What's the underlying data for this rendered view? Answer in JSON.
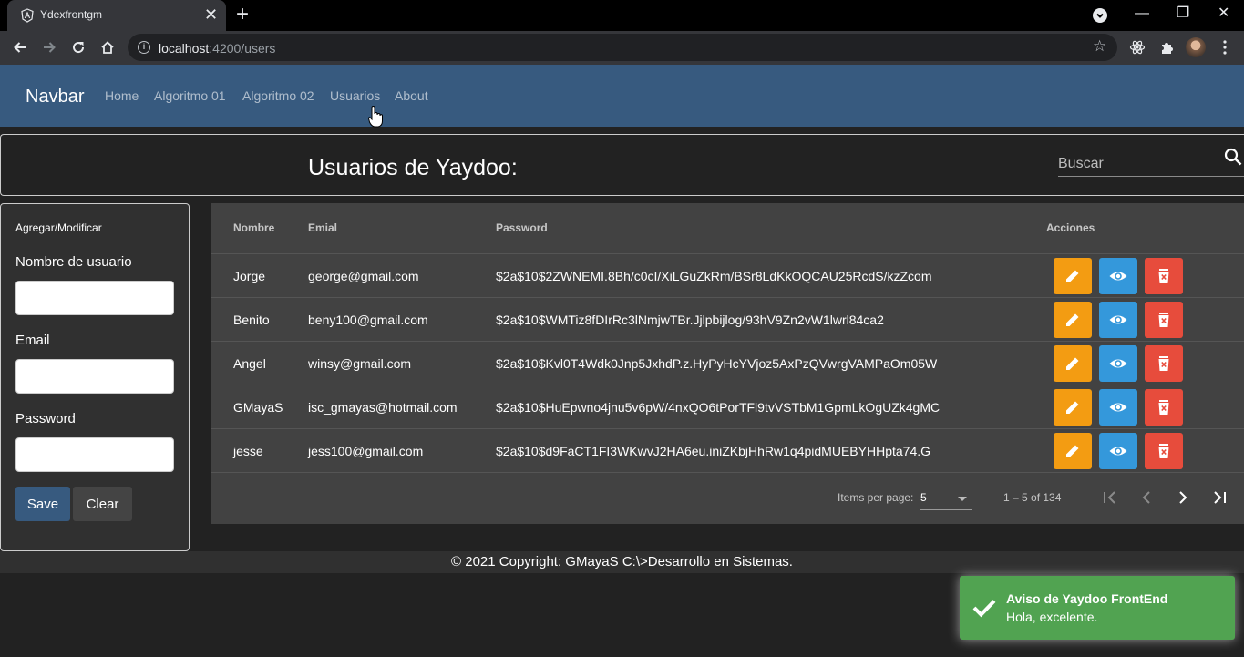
{
  "browser": {
    "tab_title": "Ydexfrontgm",
    "url_host": "localhost",
    "url_rest": ":4200/users"
  },
  "navbar": {
    "brand": "Navbar",
    "links": [
      "Home",
      "Algoritmo 01",
      "Algoritmo 02",
      "Usuarios",
      "About"
    ]
  },
  "header": {
    "title": "Usuarios de Yaydoo:",
    "search_placeholder": "Buscar"
  },
  "form": {
    "header": "Agregar/Modificar",
    "username_label": "Nombre de usuario",
    "email_label": "Email",
    "password_label": "Password",
    "save_label": "Save",
    "clear_label": "Clear"
  },
  "table": {
    "columns": [
      "Nombre",
      "Emial",
      "Password",
      "Acciones"
    ],
    "rows": [
      {
        "nombre": "Jorge",
        "email": "george@gmail.com",
        "password": "$2a$10$2ZWNEMI.8Bh/c0cI/XiLGuZkRm/BSr8LdKkOQCAU25RcdS/kzZcom"
      },
      {
        "nombre": "Benito",
        "email": "beny100@gmail.com",
        "password": "$2a$10$WMTiz8fDIrRc3lNmjwTBr.Jjlpbijlog/93hV9Zn2vW1lwrl84ca2"
      },
      {
        "nombre": "Angel",
        "email": "winsy@gmail.com",
        "password": "$2a$10$Kvl0T4Wdk0Jnp5JxhdP.z.HyPyHcYVjoz5AxPzQVwrgVAMPaOm05W"
      },
      {
        "nombre": "GMayaS",
        "email": "isc_gmayas@hotmail.com",
        "password": "$2a$10$HuEpwno4jnu5v6pW/4nxQO6tPorTFl9tvVSTbM1GpmLkOgUZk4gMC"
      },
      {
        "nombre": "jesse",
        "email": "jess100@gmail.com",
        "password": "$2a$10$d9FaCT1FI3WKwvJ2HA6eu.iniZKbjHhRw1q4pidMUEBYHHpta74.G"
      }
    ]
  },
  "paginator": {
    "items_per_page_label": "Items per page:",
    "items_per_page_value": "5",
    "range_label": "1 – 5 of 134"
  },
  "footer": {
    "text": "© 2021 Copyright: GMayaS C:\\>Desarrollo en Sistemas."
  },
  "toast": {
    "title": "Aviso de Yaydoo FrontEnd",
    "message": "Hola, excelente."
  },
  "colors": {
    "navbar": "#375a7f",
    "edit": "#f39c12",
    "view": "#3498db",
    "delete": "#e74c3c",
    "toast": "#51a351"
  }
}
